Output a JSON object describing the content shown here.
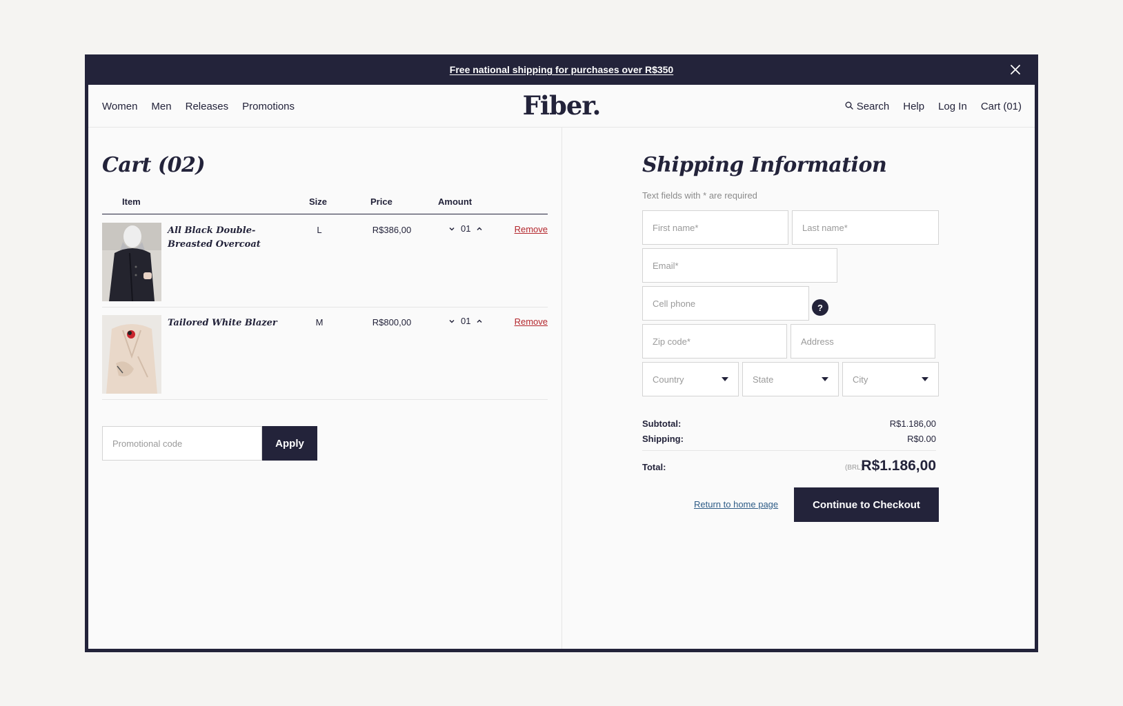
{
  "announcement": {
    "text": "Free national shipping for purchases over R$350"
  },
  "nav": {
    "left": [
      "Women",
      "Men",
      "Releases",
      "Promotions"
    ],
    "logo": "Fiber.",
    "search": "Search",
    "help": "Help",
    "login": "Log In",
    "cart": "Cart (01)"
  },
  "cart": {
    "title": "Cart (02)",
    "columns": {
      "item": "Item",
      "size": "Size",
      "price": "Price",
      "amount": "Amount"
    },
    "items": [
      {
        "name": "All Black Double-Breasted Overcoat",
        "size": "L",
        "price": "R$386,00",
        "qty": "01",
        "remove": "Remove"
      },
      {
        "name": "Tailored White Blazer",
        "size": "M",
        "price": "R$800,00",
        "qty": "01",
        "remove": "Remove"
      }
    ],
    "promo": {
      "placeholder": "Promotional code",
      "button": "Apply"
    }
  },
  "shipping": {
    "title": "Shipping Information",
    "note": "Text fields with * are required",
    "fields": {
      "first_name": "First name*",
      "last_name": "Last name*",
      "email": "Email*",
      "cell_phone": "Cell phone",
      "zip": "Zip code*",
      "address": "Address",
      "country": "Country",
      "state": "State",
      "city": "City"
    },
    "help": "?"
  },
  "summary": {
    "subtotal_label": "Subtotal:",
    "subtotal": "R$1.186,00",
    "shipping_label": "Shipping:",
    "shipping": "R$0.00",
    "total_label": "Total:",
    "currency": "(BRL)",
    "total": "R$1.186,00"
  },
  "actions": {
    "return": "Return to home page",
    "checkout": "Continue to Checkout"
  },
  "colors": {
    "primary": "#23233a",
    "danger": "#b3262c",
    "link": "#2d5b86",
    "background": "#fafafa"
  }
}
